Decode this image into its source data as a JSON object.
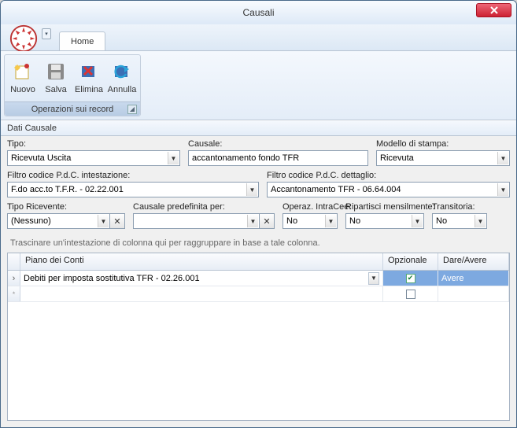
{
  "window": {
    "title": "Causali"
  },
  "tabs": {
    "home": "Home"
  },
  "ribbon": {
    "group_title": "Operazioni sui record",
    "btn_new": "Nuovo",
    "btn_save": "Salva",
    "btn_delete": "Elimina",
    "btn_undo": "Annulla"
  },
  "section": {
    "dati_causale": "Dati Causale"
  },
  "labels": {
    "tipo": "Tipo:",
    "causale": "Causale:",
    "modello": "Modello di stampa:",
    "filtro_int": "Filtro codice P.d.C. intestazione:",
    "filtro_det": "Filtro codice P.d.C. dettaglio:",
    "tipo_ricevente": "Tipo Ricevente:",
    "causale_pred": "Causale predefinita per:",
    "intracee": "Operaz. IntraCee:",
    "ripartisci": "Ripartisci mensilmente:",
    "transitoria": "Transitoria:"
  },
  "values": {
    "tipo": "Ricevuta Uscita",
    "causale": "accantonamento fondo TFR",
    "modello": "Ricevuta",
    "filtro_int": "F.do acc.to T.F.R. - 02.22.001",
    "filtro_det": "Accantonamento TFR - 06.64.004",
    "tipo_ricevente": "(Nessuno)",
    "causale_pred": "",
    "intracee": "No",
    "ripartisci": "No",
    "transitoria": "No"
  },
  "grid": {
    "group_hint": "Trascinare un'intestazione di colonna qui per raggruppare in base a tale colonna.",
    "col_piano": "Piano dei Conti",
    "col_opzionale": "Opzionale",
    "col_dareavere": "Dare/Avere",
    "rows": [
      {
        "piano": "Debiti per imposta sostitutiva TFR - 02.26.001",
        "opzionale": true,
        "dareavere": "Avere",
        "selected": true
      },
      {
        "piano": "",
        "opzionale": false,
        "dareavere": "",
        "selected": false
      }
    ]
  }
}
